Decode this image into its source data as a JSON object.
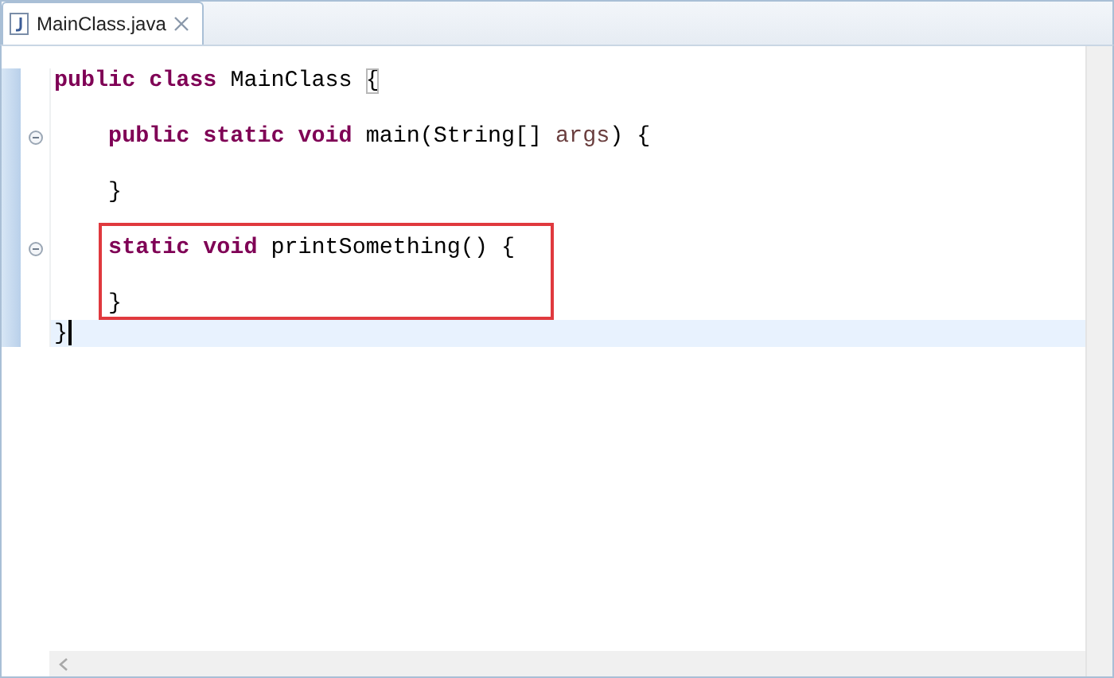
{
  "tab": {
    "title": "MainClass.java",
    "selected": true
  },
  "blocks": [
    {
      "highlighted": false,
      "lines": [
        {
          "foldable": false,
          "current": false,
          "tokens": [
            {
              "kind": "keyword",
              "text": "public "
            },
            {
              "kind": "keyword",
              "text": "class"
            },
            {
              "kind": "plain",
              "text": " MainClass "
            },
            {
              "kind": "bracket-match",
              "text": "{"
            }
          ]
        },
        {
          "foldable": false,
          "current": false
        },
        {
          "foldable": true,
          "current": false,
          "tokens": [
            {
              "kind": "keyword",
              "text": "    public "
            },
            {
              "kind": "keyword",
              "text": "static "
            },
            {
              "kind": "keyword",
              "text": "void"
            },
            {
              "kind": "plain",
              "text": " main(String[] "
            },
            {
              "kind": "param",
              "text": "args"
            },
            {
              "kind": "plain",
              "text": ") {"
            }
          ]
        },
        {
          "foldable": false,
          "current": false
        },
        {
          "foldable": false,
          "current": false,
          "tokens": [
            {
              "kind": "plain",
              "text": "    }"
            }
          ]
        },
        {
          "foldable": false,
          "current": false
        }
      ]
    },
    {
      "highlighted": true,
      "lines": [
        {
          "foldable": true,
          "current": false,
          "tokens": [
            {
              "kind": "keyword",
              "text": "    static "
            },
            {
              "kind": "keyword",
              "text": "void"
            },
            {
              "kind": "plain",
              "text": " printSomething() {"
            }
          ]
        },
        {
          "foldable": false,
          "current": false
        },
        {
          "foldable": false,
          "current": false,
          "tokens": [
            {
              "kind": "plain",
              "text": "    }"
            }
          ]
        }
      ]
    },
    {
      "highlighted": false,
      "lines": [
        {
          "foldable": false,
          "current": true,
          "tokens": [
            {
              "kind": "plain",
              "text": "}"
            }
          ]
        }
      ]
    }
  ]
}
